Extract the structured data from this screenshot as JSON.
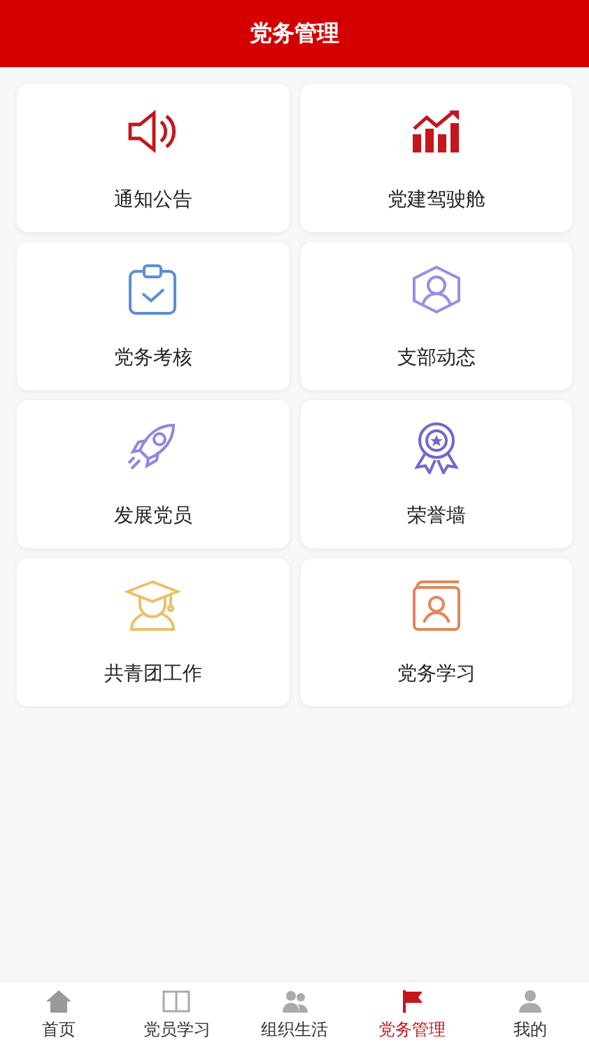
{
  "header": {
    "title": "党务管理"
  },
  "tiles": [
    {
      "label": "通知公告"
    },
    {
      "label": "党建驾驶舱"
    },
    {
      "label": "党务考核"
    },
    {
      "label": "支部动态"
    },
    {
      "label": "发展党员"
    },
    {
      "label": "荣誉墙"
    },
    {
      "label": "共青团工作"
    },
    {
      "label": "党务学习"
    }
  ],
  "tab_bar": [
    {
      "label": "首页",
      "selected": false
    },
    {
      "label": "党员学习",
      "selected": false
    },
    {
      "label": "组织生活",
      "selected": false
    },
    {
      "label": "党务管理",
      "selected": true
    },
    {
      "label": "我的",
      "selected": false
    }
  ]
}
